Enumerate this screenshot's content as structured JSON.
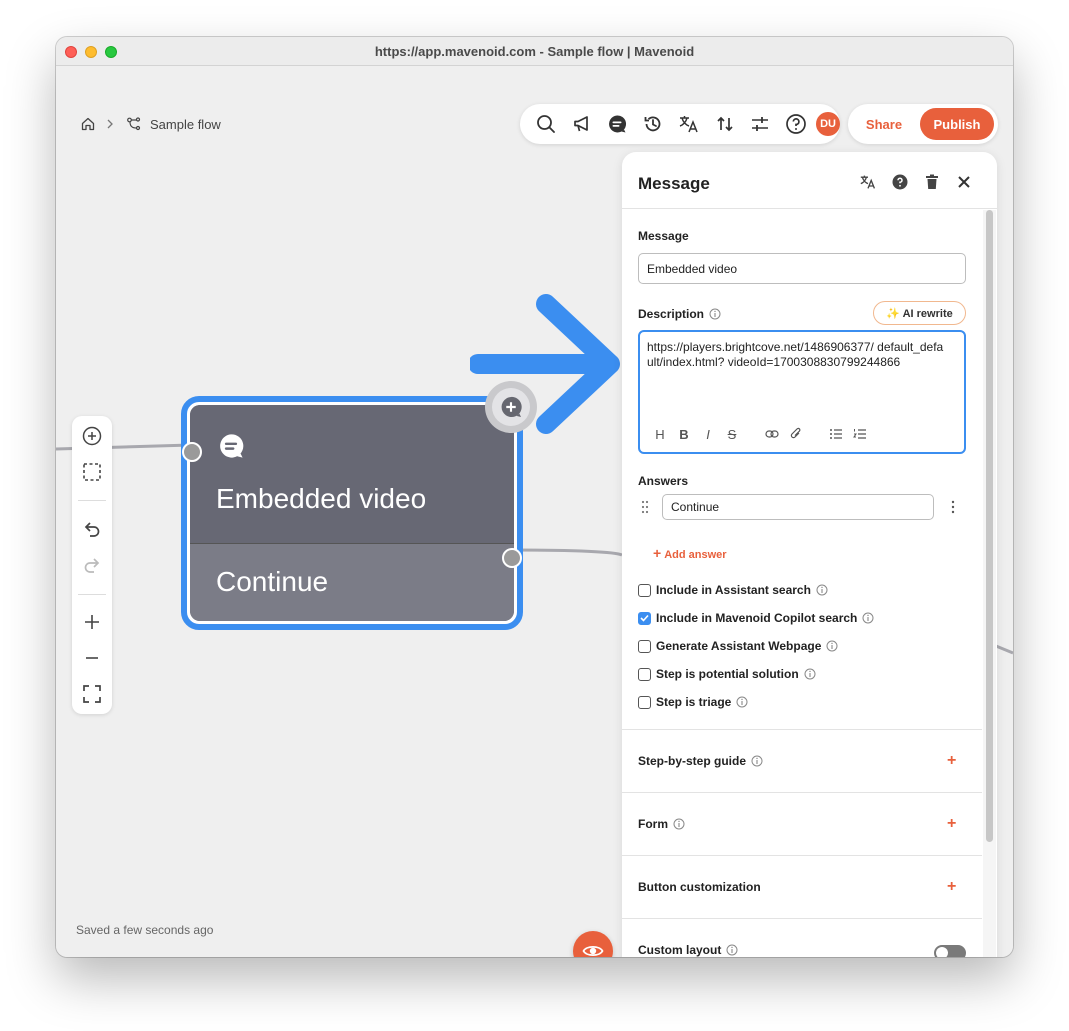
{
  "window": {
    "title": "https://app.mavenoid.com - Sample flow | Mavenoid"
  },
  "breadcrumb": {
    "home_icon": "home-icon",
    "flow_label": "Sample flow"
  },
  "toolbar": {
    "icons": [
      "search-icon",
      "megaphone-icon",
      "chat-icon",
      "history-icon",
      "translate-icon",
      "sort-icon",
      "sliders-icon",
      "help-icon"
    ],
    "avatar_initials": "DU",
    "share_label": "Share",
    "publish_label": "Publish"
  },
  "node": {
    "title": "Embedded video",
    "answer": "Continue"
  },
  "status": {
    "saved_text": "Saved a few seconds ago"
  },
  "panel": {
    "title": "Message",
    "message_label": "Message",
    "message_value": "Embedded video",
    "description_label": "Description",
    "ai_rewrite_label": "✨ AI rewrite",
    "description_value": "https://players.brightcove.net/1486906377/ default_default/index.html? videoId=1700308830799244866",
    "format_buttons": [
      "H",
      "B",
      "I",
      "S"
    ],
    "answers_label": "Answers",
    "answers": [
      "Continue"
    ],
    "add_answer_label": "Add answer",
    "options": [
      {
        "label": "Include in Assistant search",
        "checked": false
      },
      {
        "label": "Include in Mavenoid Copilot search",
        "checked": true
      },
      {
        "label": "Generate Assistant Webpage",
        "checked": false
      },
      {
        "label": "Step is potential solution",
        "checked": false
      },
      {
        "label": "Step is triage",
        "checked": false
      }
    ],
    "sections": [
      {
        "title": "Step-by-step guide",
        "action": "+"
      },
      {
        "title": "Form",
        "action": "+"
      },
      {
        "title": "Button customization",
        "action": "+"
      },
      {
        "title": "Custom layout",
        "action": "toggle"
      }
    ]
  },
  "colors": {
    "accent": "#e8603c",
    "selection": "#3b8ef0",
    "node": "#676874"
  }
}
